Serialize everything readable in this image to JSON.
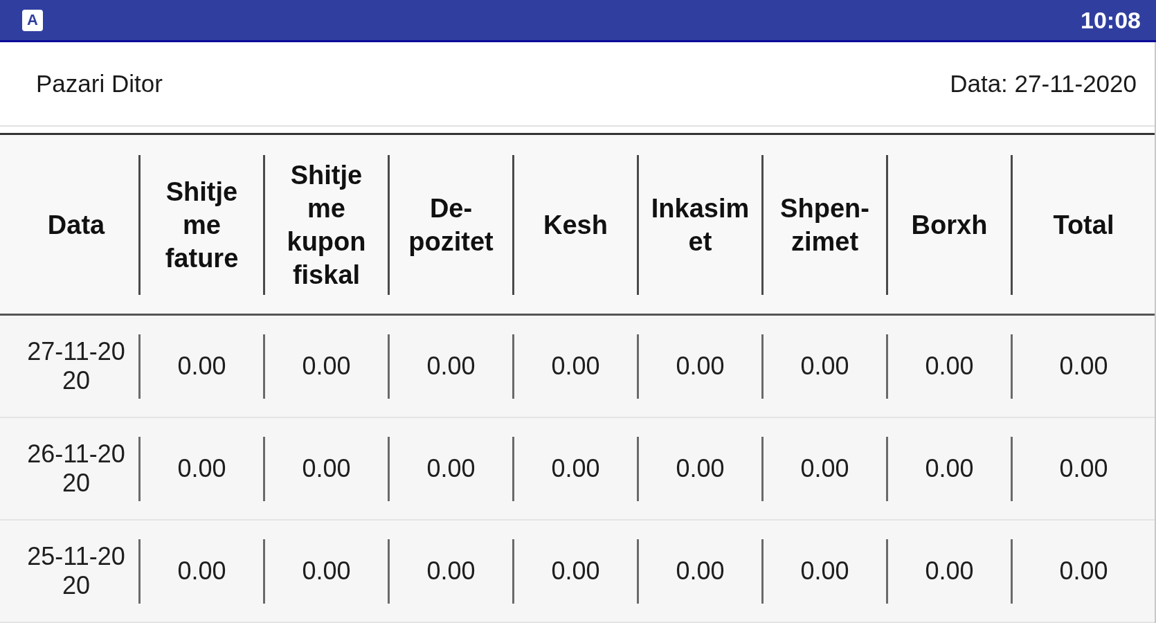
{
  "status_bar": {
    "app_icon_letter": "A",
    "time": "10:08"
  },
  "header": {
    "title": "Pazari Ditor",
    "date": "Data: 27-11-2020"
  },
  "table": {
    "columns": [
      "Data",
      "Shitje\nme\nfature",
      "Shitje\nme\nkupon\nfiskal",
      "De-\npozitet",
      "Kesh",
      "Inkasim\net",
      "Shpen-\nzimet",
      "Borxh",
      "Total"
    ],
    "rows": [
      [
        "27-11-20\n20",
        "0.00",
        "0.00",
        "0.00",
        "0.00",
        "0.00",
        "0.00",
        "0.00",
        "0.00"
      ],
      [
        "26-11-20\n20",
        "0.00",
        "0.00",
        "0.00",
        "0.00",
        "0.00",
        "0.00",
        "0.00",
        "0.00"
      ],
      [
        "25-11-20\n20",
        "0.00",
        "0.00",
        "0.00",
        "0.00",
        "0.00",
        "0.00",
        "0.00",
        "0.00"
      ]
    ]
  }
}
